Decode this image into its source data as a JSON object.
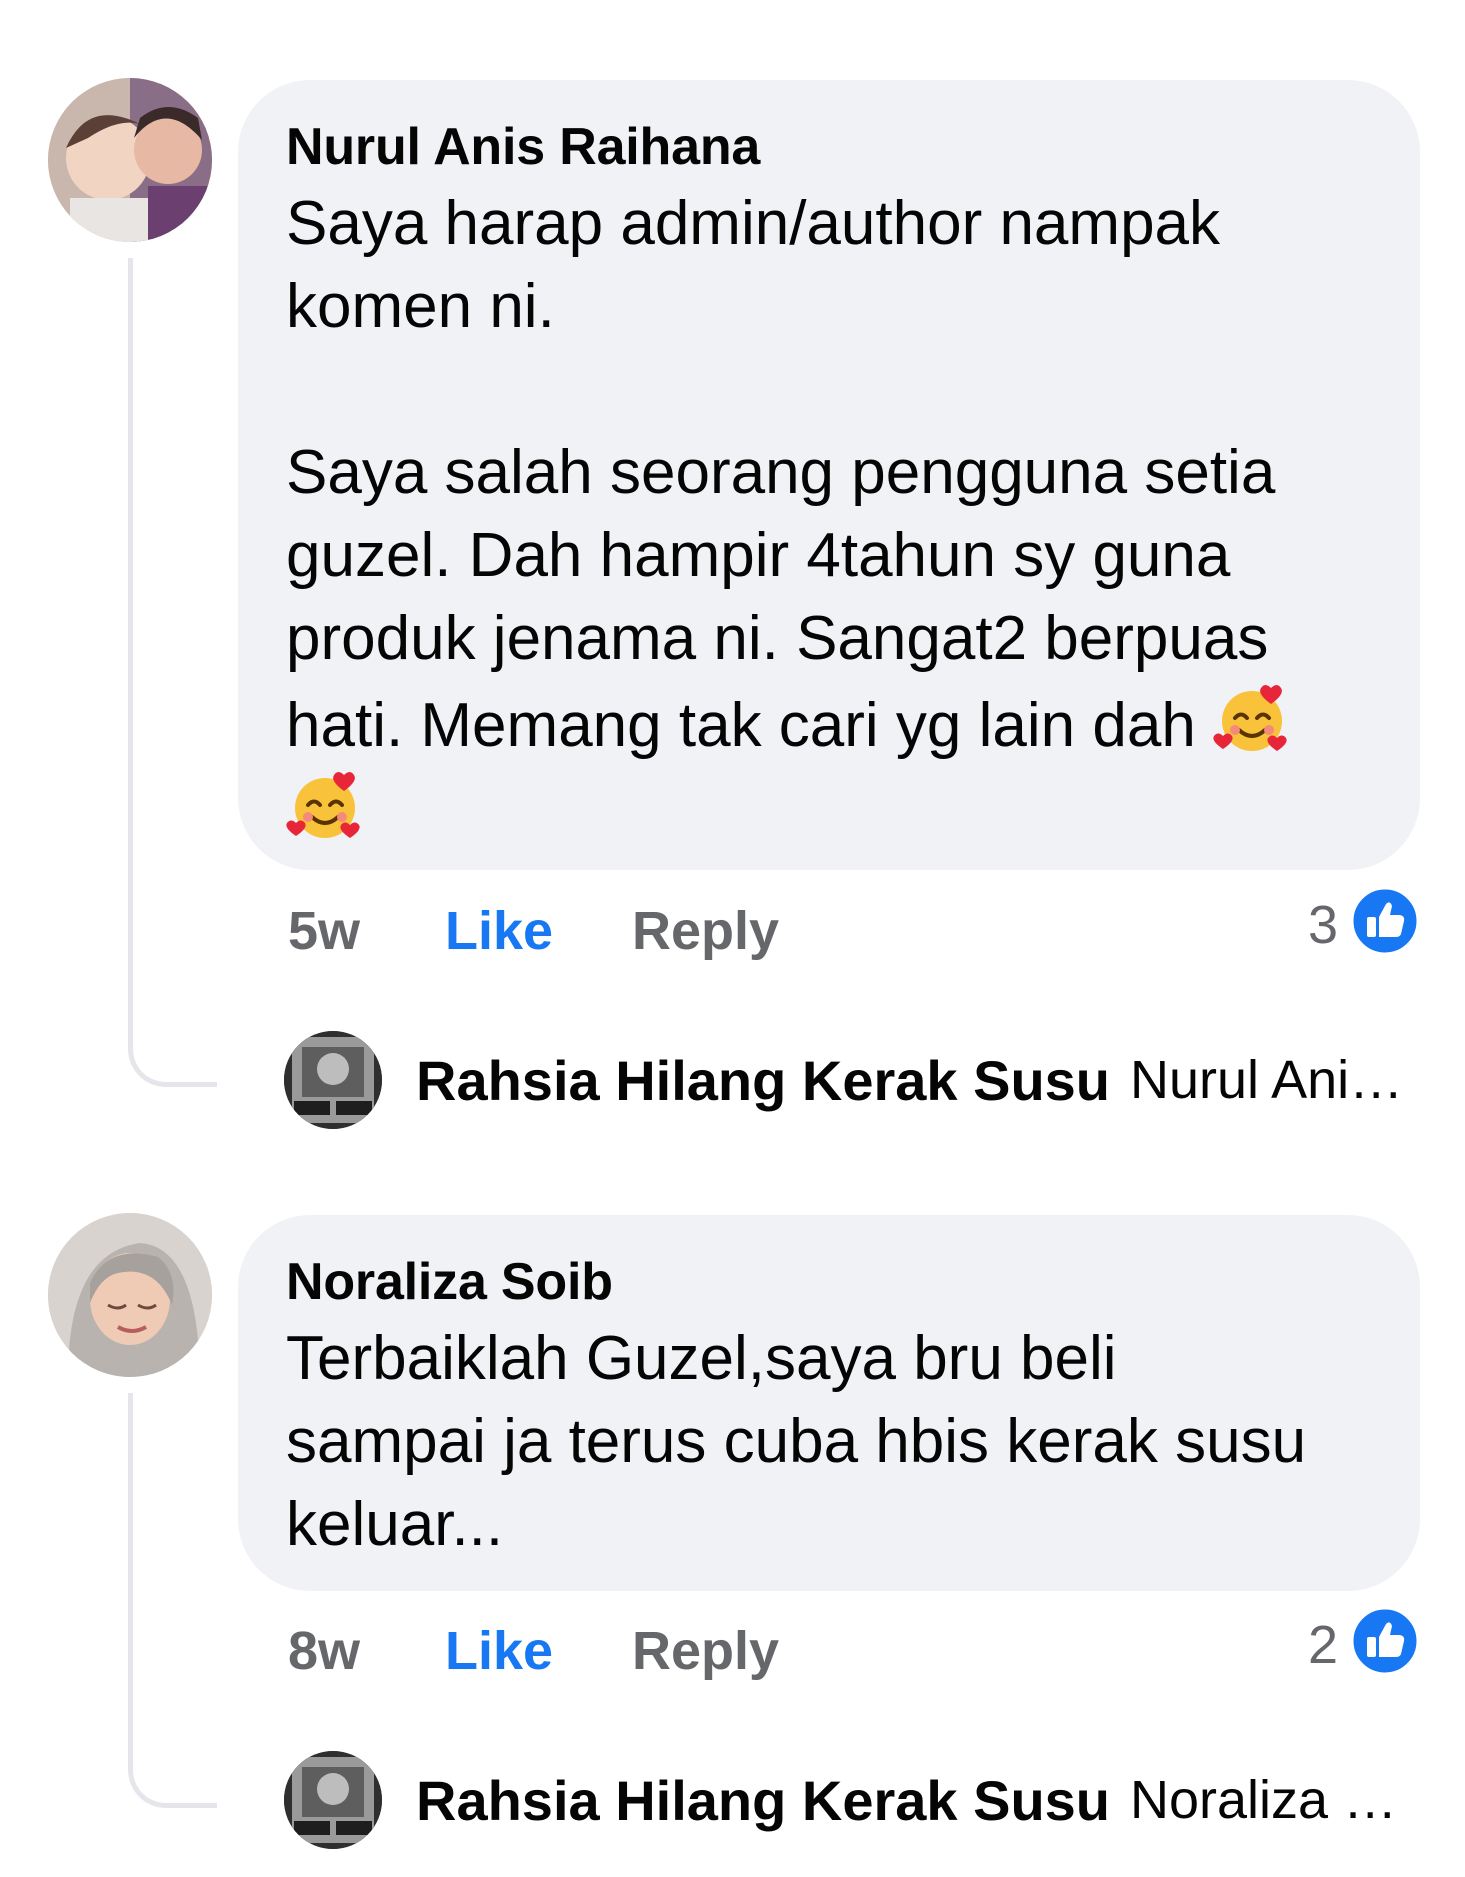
{
  "comments": [
    {
      "author": "Nurul Anis Raihana",
      "text_lines": "Saya harap admin/author nampak\nkomen ni.\n\nSaya salah seorang pengguna setia\nguzel. Dah hampir 4tahun sy guna\nproduk jenama ni. Sangat2 berpuas\nhati. Memang tak cari yg lain dah",
      "emoji": "smiling-face-with-hearts",
      "time": "5w",
      "like_label": "Like",
      "reply_label": "Reply",
      "reaction_count": "3",
      "reply_preview": {
        "author": "Rahsia Hilang Kerak Susu",
        "snippet": "Nurul Anis ..."
      }
    },
    {
      "author": "Noraliza Soib",
      "text_lines": "Terbaiklah Guzel,saya bru beli\nsampai ja terus cuba hbis kerak susu\nkeluar...",
      "time": "8w",
      "like_label": "Like",
      "reply_label": "Reply",
      "reaction_count": "2",
      "reply_preview": {
        "author": "Rahsia Hilang Kerak Susu",
        "snippet": "Noraliza Soi..."
      }
    }
  ],
  "colors": {
    "bubble": "#f0f2f5",
    "like_blue": "#1877f2",
    "muted": "#65676b",
    "thread_line": "#e4e6eb"
  }
}
